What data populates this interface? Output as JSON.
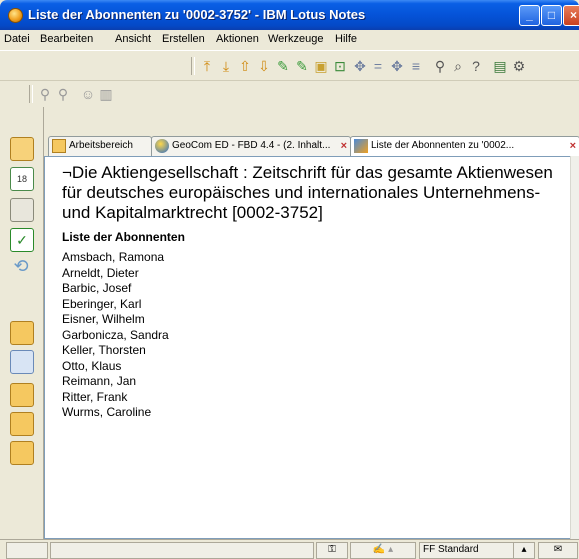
{
  "window": {
    "title": "Liste der Abonnenten zu '0002-3752' - IBM Lotus Notes",
    "controls": [
      "_",
      "□",
      "×"
    ]
  },
  "menu": [
    "Datei",
    "Bearbeiten",
    "Ansicht",
    "Erstellen",
    "Aktionen",
    "Werkzeuge",
    "Hilfe"
  ],
  "tabs": [
    {
      "label": "Arbeitsbereich",
      "icon": "folder-icon",
      "active": false
    },
    {
      "label": "GeoCom ED - FBD 4.4 - (2. Inhalt...",
      "icon": "globe-icon",
      "active": false
    },
    {
      "label": "Liste der Abonnenten zu '0002...",
      "icon": "document-icon",
      "active": true
    }
  ],
  "document": {
    "title": "¬Die Aktiengesellschaft : Zeitschrift für das gesamte Aktienwesen  für deutsches  europäisches und internationales Unternehmens- und Kapitalmarktrecht [0002-3752]",
    "list_heading": "Liste der Abonnenten",
    "subscribers": [
      "Amsbach, Ramona",
      "Arneldt, Dieter",
      "Barbic, Josef",
      "Eberinger, Karl",
      "Eisner, Wilhelm",
      "Garbonicza, Sandra",
      "Keller, Thorsten",
      "Otto, Klaus",
      "Reimann, Jan",
      "Ritter, Frank",
      "Wurms, Caroline"
    ]
  },
  "statusbar": {
    "font": "FF Standard"
  },
  "colors": {
    "titlebar": "#0553d8",
    "accent_orange": "#f0a020"
  }
}
